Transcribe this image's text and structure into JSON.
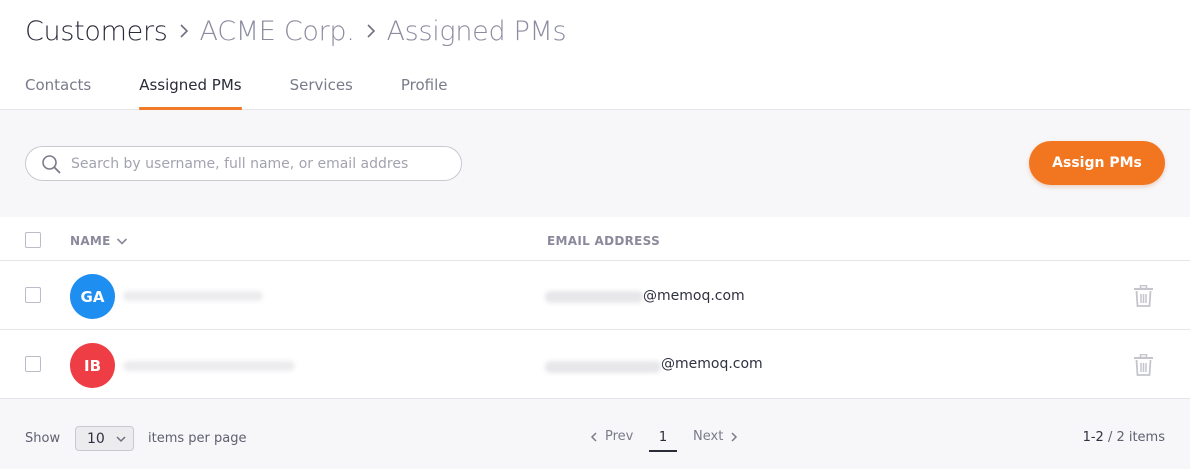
{
  "breadcrumb": {
    "items": [
      "Customers",
      "ACME Corp.",
      "Assigned PMs"
    ]
  },
  "tabs": [
    {
      "label": "Contacts",
      "active": false
    },
    {
      "label": "Assigned PMs",
      "active": true
    },
    {
      "label": "Services",
      "active": false
    },
    {
      "label": "Profile",
      "active": false
    }
  ],
  "toolbar": {
    "search_placeholder": "Search by username, full name, or email addres",
    "search_value": "",
    "assign_button_label": "Assign PMs"
  },
  "table": {
    "columns": {
      "name": "NAME",
      "email": "EMAIL ADDRESS"
    },
    "rows": [
      {
        "initials": "GA",
        "avatar_color": "#1e8ff0",
        "email_domain": "@memoq.com"
      },
      {
        "initials": "IB",
        "avatar_color": "#ee3d44",
        "email_domain": "@memoq.com"
      }
    ]
  },
  "footer": {
    "show_label": "Show",
    "page_size": "10",
    "items_per_page_label": "items per page",
    "prev_label": "Prev",
    "current_page": "1",
    "next_label": "Next",
    "range": "1-2",
    "total": "/ 2 items"
  },
  "colors": {
    "accent": "#f27520",
    "text": "#2f3040",
    "muted": "#8a8a9c"
  },
  "icons": [
    "chevron-right-icon",
    "search-icon",
    "chevron-down-icon",
    "trash-icon",
    "chevron-left-icon"
  ]
}
